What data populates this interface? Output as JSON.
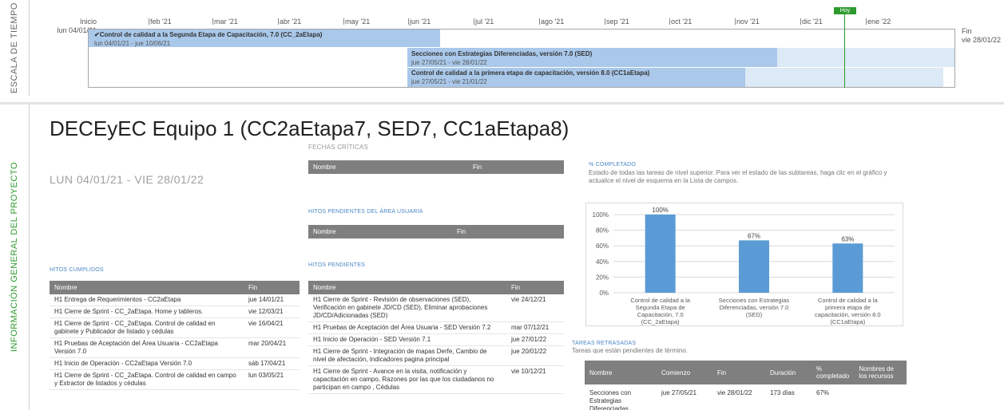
{
  "timeline": {
    "side_label": "ESCALA DE TIEMPO",
    "start_label": "Inicio",
    "start_date": "lun 04/01/21",
    "end_label": "Fin",
    "end_date": "vie 28/01/22",
    "months": [
      "feb '21",
      "mar '21",
      "abr '21",
      "may '21",
      "jun '21",
      "jul '21",
      "ago '21",
      "sep '21",
      "oct '21",
      "nov '21",
      "dic '21",
      "ene '22"
    ],
    "today_badge": "Hoy",
    "bars": [
      {
        "title": "✔Control de calidad a la Segunda Etapa de Capacitación, 7.0 (CC_2aEtapa)",
        "dates": "lun 04/01/21 - jue 10/06/21"
      },
      {
        "title": "Secciones con Estrategias Diferenciadas, versión 7.0 (SED)",
        "dates": "jue 27/05/21 - vie 28/01/22"
      },
      {
        "title": "Control de calidad a la primera etapa de capacitación, versión 8.0 (CC1aEtapa)",
        "dates": "jue 27/05/21 - vie 21/01/22"
      }
    ]
  },
  "info": {
    "side_label": "INFORMACIÓN GENERAL DEL PROYECTO",
    "title": "DECEyEC Equipo 1 (CC2aEtapa7, SED7, CC1aEtapa8)",
    "dates": "LUN 04/01/21 -  VIE 28/01/22"
  },
  "fechas_criticas": {
    "label": "FECHAS CRÍTICAS",
    "headers": [
      "Nombre",
      "Fin"
    ]
  },
  "hitos_area": {
    "label": "HITOS PENDIENTES DEL ÁREA USUARIA",
    "headers": [
      "Nombre",
      "Fin"
    ]
  },
  "hitos_cumplidos": {
    "label": "HITOS CUMPLIDOS",
    "headers": [
      "Nombre",
      "Fin"
    ],
    "rows": [
      [
        "H1 Entrega de Requerimientos - CC2aEtapa",
        "jue 14/01/21"
      ],
      [
        "H1 Cierre de Sprint - CC_2aEtapa. Home y tableros.",
        "vie 12/03/21"
      ],
      [
        "H1 Cierre de Sprint - CC_2aEtapa. Control de calidad en gabinete y Publicador de listado y cédulas",
        "vie 16/04/21"
      ],
      [
        "H1 Pruebas de Aceptación del Área Usuaria - CC2aEtapa Versión 7.0",
        "mar 20/04/21"
      ],
      [
        "H1 Inicio de Operación - CC2aEtapa Versión 7.0",
        "sáb 17/04/21"
      ],
      [
        "H1 Cierre de Sprint - CC_2aEtapa. Control de calidad en campo y Extractor de listados y cédulas",
        "lun 03/05/21"
      ]
    ]
  },
  "hitos_pendientes": {
    "label": "HITOS PENDIENTES",
    "headers": [
      "Nombre",
      "Fin"
    ],
    "rows": [
      [
        "H1 Cierre de Sprint -  Revisión de observaciones (SED), Verificación en gabinete JD/CD (SED), Eliminar aprobaciones JD/CD/Adicionadas (SED)",
        "vie 24/12/21"
      ],
      [
        "H1 Pruebas de Aceptación del Área Usuaria - SED Versión 7.2",
        "mar 07/12/21"
      ],
      [
        "H1 Inicio de Operación - SED Versión 7.1",
        "jue 27/01/22"
      ],
      [
        "H1 Cierre de Sprint - Integración de mapas Derfe, Cambio de nivel de afectación, Indicadores pagina principal",
        "jue 20/01/22"
      ],
      [
        "H1 Cierre de Sprint - Avance en la visita, notificación y capacitación en campo, Razones por las que los ciudadanos no participan en campo , Cédulas",
        "vie 10/12/21"
      ]
    ]
  },
  "completado": {
    "label": "% COMPLETADO",
    "description": "Estado de todas las tareas de nivel superior. Para ver el estado de las subtareas, haga clic en el gráfico y actualice el nivel de esquema en la Lista de campos."
  },
  "chart_data": {
    "type": "bar",
    "categories": [
      "Control de calidad a la Segunda Etapa de Capacitación, 7.0 (CC_2aEtapa)",
      "Secciones con Estrategias Diferenciadas, versión 7.0 (SED)",
      "Control de calidad a la primera etapa de capacitación, versión 8.0 (CC1aEtapa)"
    ],
    "values": [
      100,
      67,
      63
    ],
    "data_labels": [
      "100%",
      "67%",
      "63%"
    ],
    "yticks": [
      "0%",
      "20%",
      "40%",
      "60%",
      "80%",
      "100%"
    ],
    "ylim": [
      0,
      100
    ],
    "bar_color": "#5b9bd5",
    "grid": true
  },
  "tareas_retrasadas": {
    "label": "TAREAS RETRASADAS",
    "subtitle": "Tareas que están pendientes de término.",
    "headers": [
      "Nombre",
      "Comienzo",
      "Fin",
      "Duración",
      "% completado",
      "Nombres de los recursos"
    ],
    "rows": [
      [
        "Secciones con Estrategias Diferenciadas",
        "jue 27/05/21",
        "vie 28/01/22",
        "173 días",
        "67%",
        ""
      ]
    ]
  },
  "colors": {
    "accent_green": "#2e9a2e",
    "section_blue": "#4a86c5",
    "bar_strong": "#a9c8ea",
    "bar_light": "#dce9f6",
    "header_gray": "#7f7f7f"
  }
}
